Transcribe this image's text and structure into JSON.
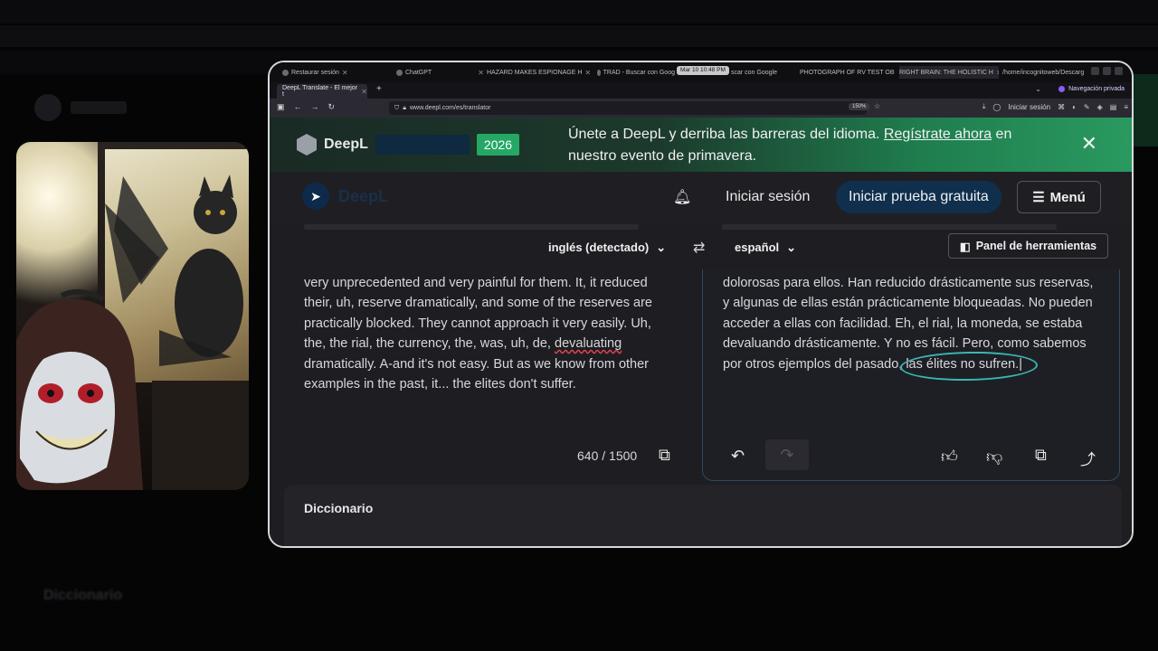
{
  "background": {
    "ghost_dict_label": "Diccionario"
  },
  "browser": {
    "tabs": [
      {
        "label": "Restaurar sesión"
      },
      {
        "label": "ChatGPT"
      },
      {
        "label": "HAZARD MAKES ESPIONAGE H"
      },
      {
        "label": "TRAD - Buscar con Goog"
      },
      {
        "label": "scar con Google"
      },
      {
        "label": "PHOTOGRAPH OF RV TEST OB"
      },
      {
        "label": "RIGHT BRAIN: THE HOLISTIC H"
      },
      {
        "label": "/home/incognitoweb/Descarg"
      }
    ],
    "clock": "Mar 10  10:48 PM",
    "active_tab": "DeepL Translate - El mejor t",
    "private_label": "Navegación privada",
    "url": "www.deepl.com/es/translator",
    "zoom": "150%",
    "login_label": "Iniciar sesión"
  },
  "banner": {
    "brand": "DeepL",
    "year": "2026",
    "text_before_link": "Únete a DeepL y derriba las barreras del idioma. ",
    "link": "Regístrate ahora",
    "text_after_link": " en nuestro evento de primavera."
  },
  "header": {
    "brand": "DeepL",
    "login": "Iniciar sesión",
    "trial": "Iniciar prueba gratuita",
    "menu": "Menú"
  },
  "translator": {
    "source_lang": "inglés (detectado)",
    "target_lang": "español",
    "tools_panel": "Panel de herramientas",
    "source_text_1": "very unprecedented and very painful for them. It, it reduced their, uh, reserve dramatically, and some of the reserves are practically blocked. They cannot approach it very easily. Uh, the, the rial, the currency, the, was, uh, de, ",
    "source_text_squiggle": "devaluating",
    "source_text_2": " dramatically. A-and it's not easy. But as we know from other examples in the past, it... the elites don't suffer.",
    "target_text_1": "dolorosas para ellos. Han reducido drásticamente sus reservas, y algunas de ellas están prácticamente bloqueadas. No pueden acceder a ellas con facilidad. Eh, el rial, la moneda, se estaba devaluando drásticamente. Y no es fácil. Pero, como sabemos por otros ejemplos del pasado, ",
    "target_text_marked": "las élites no sufren.",
    "char_count": "640 / 1500"
  },
  "dictionary": {
    "title": "Diccionario"
  },
  "colors": {
    "accent_green": "#25a865",
    "brand_navy": "#0f2f4d",
    "annotation_teal": "#3ab7b3",
    "spell_red": "#e0464f"
  }
}
